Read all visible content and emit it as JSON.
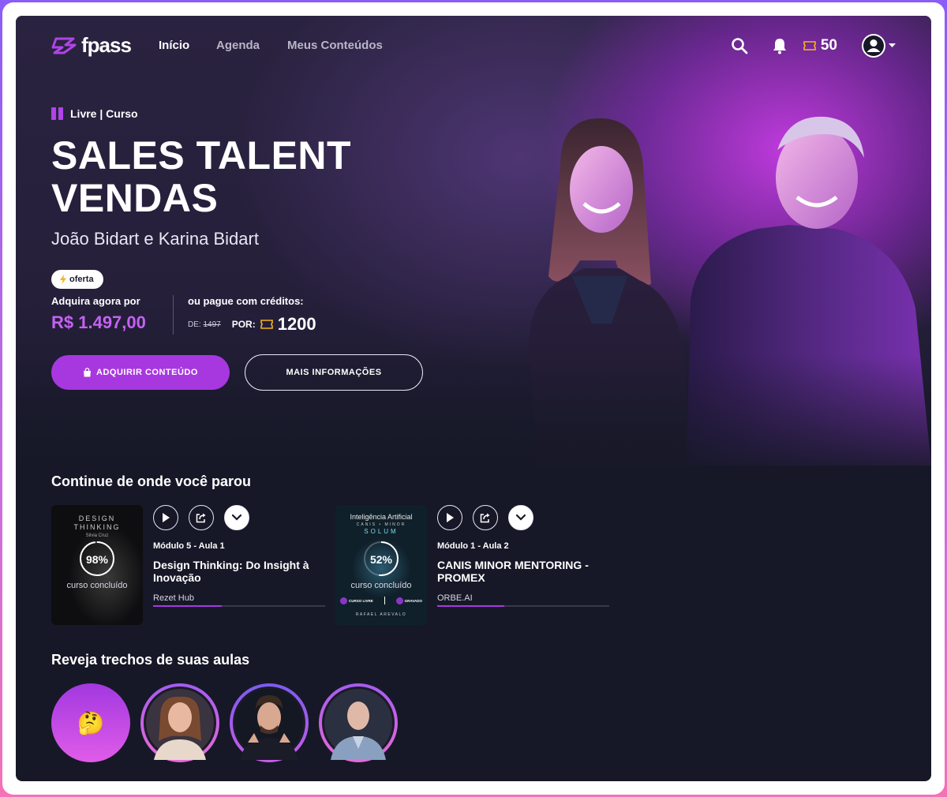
{
  "nav": {
    "logo_text": "fpass",
    "links": [
      "Início",
      "Agenda",
      "Meus Conteúdos"
    ],
    "credits": "50"
  },
  "hero": {
    "tag": "Livre | Curso",
    "title": "SALES TALENT VENDAS",
    "subtitle": "João Bidart e Karina Bidart",
    "badge": "oferta",
    "buy_label": "Adquira agora por",
    "price": "R$ 1.497,00",
    "credits_label": "ou pague com créditos:",
    "de_label": "DE:",
    "de_value": "1497",
    "por_label": "POR:",
    "por_value": "1200",
    "primary_button": "ADQUIRIR CONTEÚDO",
    "secondary_button": "MAIS INFORMAÇÕES"
  },
  "continue": {
    "title": "Continue de onde você parou",
    "cards": [
      {
        "thumb_title": "DESIGN THINKING",
        "thumb_author": "Silvia Cruz",
        "progress": "98%",
        "progress_value": 0.98,
        "status": "curso concluído",
        "module": "Módulo 5 - Aula 1",
        "title": "Design Thinking: Do Insight à Inovação",
        "provider": "Rezet Hub",
        "track_progress": 0.4
      },
      {
        "thumb_title": "Inteligência Artificial",
        "thumb_sub": "CANIS • MINOR",
        "thumb_brand": "SOLUM",
        "thumb_tag1": "CURSO LIVRE",
        "thumb_tag2": "GRAVADO",
        "thumb_author": "RAFAEL AREVALO",
        "progress": "52%",
        "progress_value": 0.52,
        "status": "curso concluído",
        "module": "Módulo 1 - Aula 2",
        "title": "CANIS MINOR MENTORING - PROMEX",
        "provider": "ORBE.AI",
        "track_progress": 0.39
      }
    ]
  },
  "clips": {
    "title": "Reveja trechos de suas aulas",
    "first_emoji": "🤔"
  },
  "colors": {
    "accent": "#a738e0",
    "price": "#c462f2",
    "background": "#161827"
  }
}
